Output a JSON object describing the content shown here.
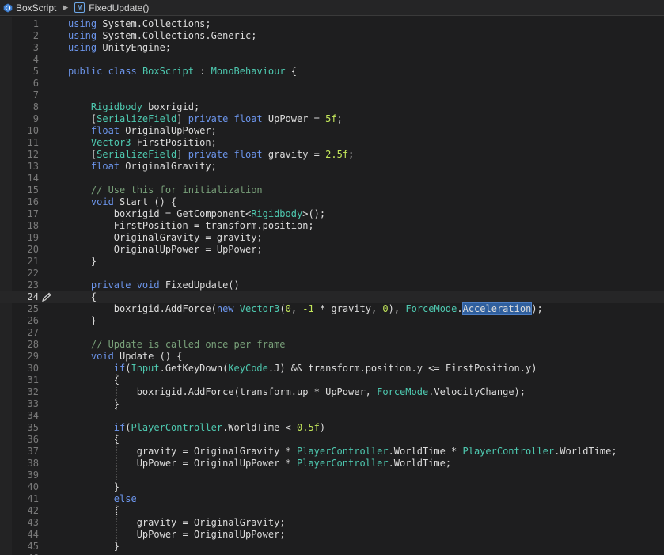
{
  "breadcrumb": {
    "file": "BoxScript",
    "method": "FixedUpdate()",
    "method_badge": "M"
  },
  "colors": {
    "keyword": "#6c95eb",
    "type": "#4ec9b0",
    "number": "#c4e85b",
    "comment": "#79a17a",
    "plain": "#dcdcdc",
    "selection": "#2f5f9e"
  },
  "editor": {
    "current_line": 24,
    "lines": [
      [
        [
          "k",
          "using"
        ],
        [
          "p",
          " System.Collections;"
        ]
      ],
      [
        [
          "k",
          "using"
        ],
        [
          "p",
          " System.Collections.Generic;"
        ]
      ],
      [
        [
          "k",
          "using"
        ],
        [
          "p",
          " UnityEngine;"
        ]
      ],
      [],
      [
        [
          "k",
          "public class"
        ],
        [
          "p",
          " "
        ],
        [
          "t",
          "BoxScript"
        ],
        [
          "p",
          " : "
        ],
        [
          "t",
          "MonoBehaviour"
        ],
        [
          "p",
          " {"
        ]
      ],
      [],
      [],
      [
        [
          "p",
          "    "
        ],
        [
          "t",
          "Rigidbody"
        ],
        [
          "p",
          " boxrigid;"
        ]
      ],
      [
        [
          "p",
          "    ["
        ],
        [
          "t",
          "SerializeField"
        ],
        [
          "p",
          "] "
        ],
        [
          "k",
          "private float"
        ],
        [
          "p",
          " UpPower = "
        ],
        [
          "n",
          "5f"
        ],
        [
          "p",
          ";"
        ]
      ],
      [
        [
          "p",
          "    "
        ],
        [
          "k",
          "float"
        ],
        [
          "p",
          " OriginalUpPower;"
        ]
      ],
      [
        [
          "p",
          "    "
        ],
        [
          "t",
          "Vector3"
        ],
        [
          "p",
          " FirstPosition;"
        ]
      ],
      [
        [
          "p",
          "    ["
        ],
        [
          "t",
          "SerializeField"
        ],
        [
          "p",
          "] "
        ],
        [
          "k",
          "private float"
        ],
        [
          "p",
          " gravity = "
        ],
        [
          "n",
          "2.5f"
        ],
        [
          "p",
          ";"
        ]
      ],
      [
        [
          "p",
          "    "
        ],
        [
          "k",
          "float"
        ],
        [
          "p",
          " OriginalGravity;"
        ]
      ],
      [],
      [
        [
          "c",
          "    // Use this for initialization"
        ]
      ],
      [
        [
          "p",
          "    "
        ],
        [
          "k",
          "void"
        ],
        [
          "p",
          " Start () {"
        ]
      ],
      [
        [
          "p",
          "        boxrigid = GetComponent<"
        ],
        [
          "t",
          "Rigidbody"
        ],
        [
          "p",
          ">();"
        ]
      ],
      [
        [
          "p",
          "        FirstPosition = transform.position;"
        ]
      ],
      [
        [
          "p",
          "        OriginalGravity = gravity;"
        ]
      ],
      [
        [
          "p",
          "        OriginalUpPower = UpPower;"
        ]
      ],
      [
        [
          "p",
          "    }"
        ]
      ],
      [],
      [
        [
          "k",
          "    private void"
        ],
        [
          "p",
          " FixedUpdate()"
        ]
      ],
      [
        [
          "p",
          "    {"
        ]
      ],
      [
        [
          "p",
          "        boxrigid.AddForce("
        ],
        [
          "k",
          "new"
        ],
        [
          "p",
          " "
        ],
        [
          "t",
          "Vector3"
        ],
        [
          "p",
          "("
        ],
        [
          "n",
          "0"
        ],
        [
          "p",
          ", "
        ],
        [
          "n",
          "-1"
        ],
        [
          "p",
          " * gravity, "
        ],
        [
          "n",
          "0"
        ],
        [
          "p",
          "), "
        ],
        [
          "t",
          "ForceMode"
        ],
        [
          "p",
          "."
        ],
        [
          "s",
          "Acceleration"
        ],
        [
          "p",
          ");"
        ]
      ],
      [
        [
          "p",
          "    }"
        ]
      ],
      [],
      [
        [
          "c",
          "    // Update is called once per frame"
        ]
      ],
      [
        [
          "p",
          "    "
        ],
        [
          "k",
          "void"
        ],
        [
          "p",
          " Update () {"
        ]
      ],
      [
        [
          "p",
          "        "
        ],
        [
          "k",
          "if"
        ],
        [
          "p",
          "("
        ],
        [
          "t",
          "Input"
        ],
        [
          "p",
          ".GetKeyDown("
        ],
        [
          "t",
          "KeyCode"
        ],
        [
          "p",
          ".J) && transform.position.y <= FirstPosition.y)"
        ]
      ],
      [
        [
          "p",
          "        {"
        ]
      ],
      [
        [
          "p",
          "            boxrigid.AddForce(transform.up * UpPower, "
        ],
        [
          "t",
          "ForceMode"
        ],
        [
          "p",
          ".VelocityChange);"
        ]
      ],
      [
        [
          "p",
          "        }"
        ]
      ],
      [],
      [
        [
          "p",
          "        "
        ],
        [
          "k",
          "if"
        ],
        [
          "p",
          "("
        ],
        [
          "t",
          "PlayerController"
        ],
        [
          "p",
          ".WorldTime < "
        ],
        [
          "n",
          "0.5f"
        ],
        [
          "p",
          ")"
        ]
      ],
      [
        [
          "p",
          "        {"
        ]
      ],
      [
        [
          "p",
          "            gravity = OriginalGravity * "
        ],
        [
          "t",
          "PlayerController"
        ],
        [
          "p",
          ".WorldTime * "
        ],
        [
          "t",
          "PlayerController"
        ],
        [
          "p",
          ".WorldTime;"
        ]
      ],
      [
        [
          "p",
          "            UpPower = OriginalUpPower * "
        ],
        [
          "t",
          "PlayerController"
        ],
        [
          "p",
          ".WorldTime;"
        ]
      ],
      [],
      [
        [
          "p",
          "        }"
        ]
      ],
      [
        [
          "k",
          "        else"
        ]
      ],
      [
        [
          "p",
          "        {"
        ]
      ],
      [
        [
          "p",
          "            gravity = OriginalGravity;"
        ]
      ],
      [
        [
          "p",
          "            UpPower = OriginalUpPower;"
        ]
      ],
      [
        [
          "p",
          "        }"
        ]
      ],
      [],
      [
        [
          "p",
          "    }"
        ]
      ]
    ]
  }
}
